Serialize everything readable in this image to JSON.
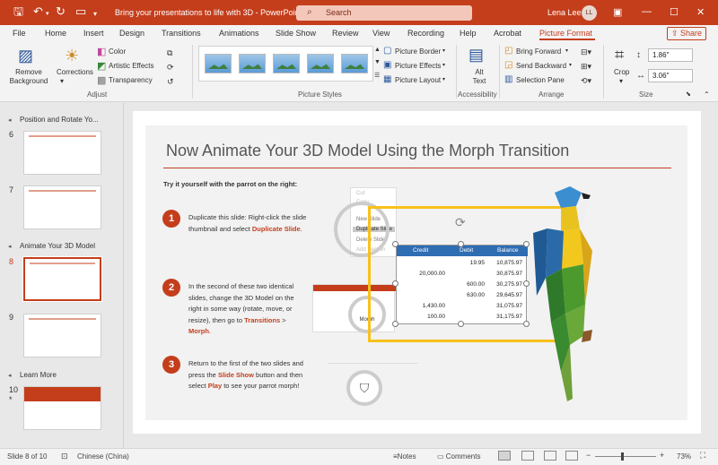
{
  "titlebar": {
    "document_title": "Bring your presentations to life with 3D  -  PowerPoint",
    "search_placeholder": "Search",
    "user_name": "Lena Lee",
    "user_initials": "LL",
    "bg_color": "#c43e1c"
  },
  "tabs": [
    "File",
    "Home",
    "Insert",
    "Design",
    "Transitions",
    "Animations",
    "Slide Show",
    "Review",
    "View",
    "Recording",
    "Help",
    "Acrobat",
    "Picture Format"
  ],
  "active_tab": "Picture Format",
  "share_label": "Share",
  "ribbon": {
    "remove_background": "Remove Background",
    "corrections": "Corrections",
    "color": "Color",
    "artistic_effects": "Artistic Effects",
    "transparency": "Transparency",
    "adjust_group": "Adjust",
    "picture_styles_group": "Picture Styles",
    "picture_border": "Picture Border",
    "picture_effects": "Picture Effects",
    "picture_layout": "Picture Layout",
    "alt_text": "Alt Text",
    "accessibility_group": "Accessibility",
    "bring_forward": "Bring Forward",
    "send_backward": "Send Backward",
    "selection_pane": "Selection Pane",
    "arrange_group": "Arrange",
    "crop": "Crop",
    "height_value": "1.86\"",
    "width_value": "3.06\"",
    "size_group": "Size"
  },
  "slide_panel": {
    "section_1": "Position and Rotate Yo...",
    "section_2": "Animate Your 3D Model",
    "section_3": "Learn More",
    "slide_numbers": [
      "6",
      "7",
      "8",
      "9",
      "10"
    ],
    "selected_slide": "8",
    "slide_10_marker": "*"
  },
  "slide": {
    "title": "Now Animate Your 3D Model Using the Morph Transition",
    "subtitle": "Try it yourself with the parrot on the right:",
    "step1_num": "1",
    "step1_text": "Duplicate this slide: Right-click the slide thumbnail and select ",
    "step1_em": "Duplicate Slide",
    "step1_end": ".",
    "step2_num": "2",
    "step2_text": "In the second of these two identical slides, change the 3D Model on the right in some way (rotate, move, or resize), then go to ",
    "step2_em1": "Transitions",
    "step2_sep": " > ",
    "step2_em2": "Morph",
    "step2_end": ".",
    "step3_num": "3",
    "step3_text1": "Return to the first of the two slides and press the ",
    "step3_em1": "Slide Show",
    "step3_text2": " button and then select ",
    "step3_em2": "Play",
    "step3_text3": " to see your parrot morph!",
    "context_menu": [
      "Cut",
      "Copy",
      "New Slide",
      "Duplicate Slide",
      "Delete Slide",
      "Add Section"
    ],
    "morph_label": "Morph",
    "table": {
      "headers": [
        "Credit",
        "Debit",
        "Balance"
      ],
      "rows": [
        [
          "",
          "19.95",
          "10,875.97"
        ],
        [
          "20,000.00",
          "",
          "30,875.97"
        ],
        [
          "",
          "600.00",
          "30,275.97"
        ],
        [
          "",
          "630.00",
          "29,645.97"
        ],
        [
          "1,430.00",
          "",
          "31,075.97"
        ],
        [
          "100.00",
          "",
          "31,175.97"
        ]
      ]
    }
  },
  "status": {
    "slide_indicator": "Slide 8 of 10",
    "language": "Chinese (China)",
    "notes": "Notes",
    "comments": "Comments",
    "zoom": "73%"
  }
}
